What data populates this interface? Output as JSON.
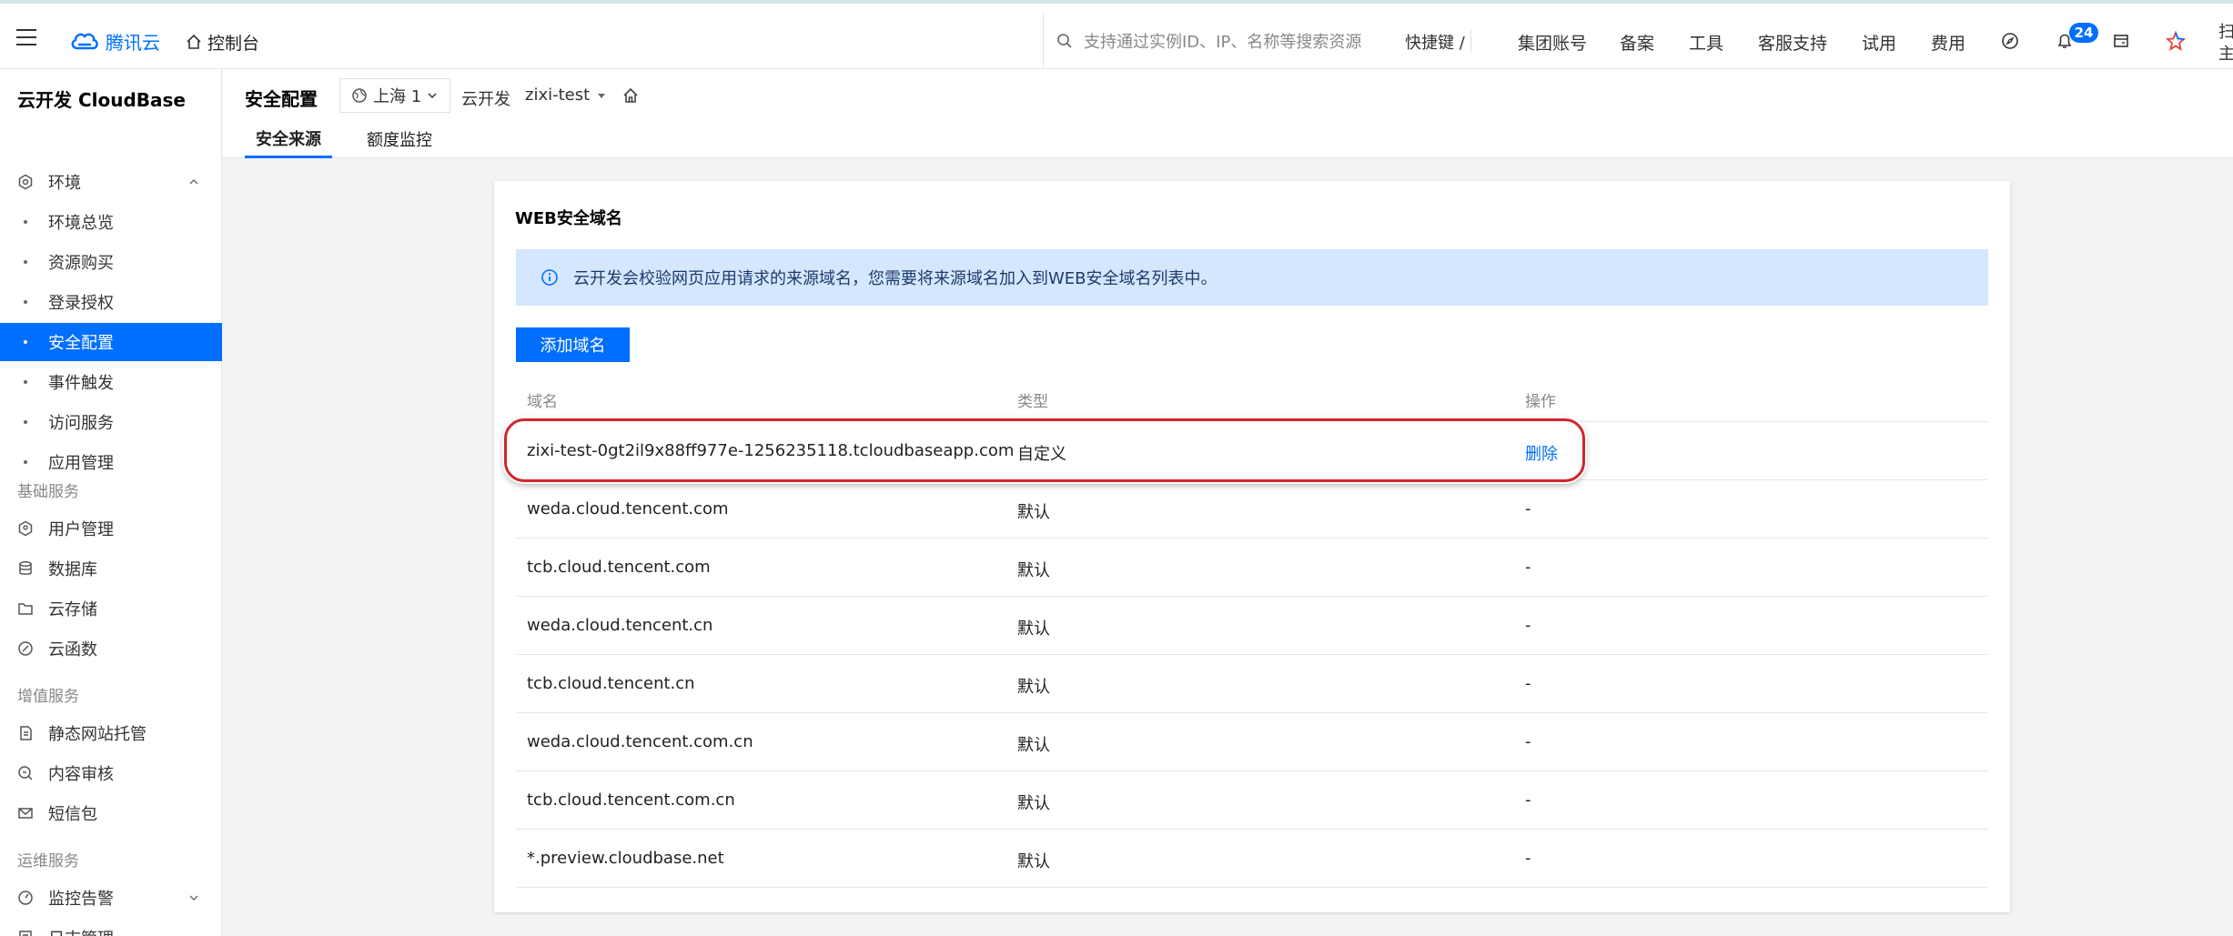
{
  "header": {
    "brand": "腾讯云",
    "console": "控制台",
    "search_placeholder": "支持通过实例ID、IP、名称等搜索资源",
    "shortcut": "快捷键 /",
    "nav": [
      "集团账号",
      "备案",
      "工具",
      "客服支持",
      "试用",
      "费用"
    ],
    "notification_count": "24",
    "edge_text": [
      "扫",
      "主"
    ]
  },
  "sidebar": {
    "title": "云开发 CloudBase",
    "env_section": "环境",
    "env_items": [
      "环境总览",
      "资源购买",
      "登录授权",
      "安全配置",
      "事件触发",
      "访问服务",
      "应用管理"
    ],
    "active_item": "安全配置",
    "group_basic": "基础服务",
    "basic_items": [
      "用户管理",
      "数据库",
      "云存储",
      "云函数"
    ],
    "group_value": "增值服务",
    "value_items": [
      "静态网站托管",
      "内容审核",
      "短信包"
    ],
    "group_ops": "运维服务",
    "ops_items": [
      "监控告警",
      "日志管理"
    ]
  },
  "page": {
    "title": "安全配置",
    "region": "上海 1",
    "env_label": "云开发",
    "env_value": "zixi-test",
    "tabs": [
      "安全来源",
      "额度监控"
    ],
    "active_tab": "安全来源"
  },
  "card": {
    "title": "WEB安全域名",
    "notice": "云开发会校验网页应用请求的来源域名，您需要将来源域名加入到WEB安全域名列表中。",
    "add_button": "添加域名",
    "columns": [
      "域名",
      "类型",
      "操作"
    ],
    "rows": [
      {
        "domain": "zixi-test-0gt2il9x88ff977e-1256235118.tcloudbaseapp.com",
        "type": "自定义",
        "action": "删除"
      },
      {
        "domain": "weda.cloud.tencent.com",
        "type": "默认",
        "action": "-"
      },
      {
        "domain": "tcb.cloud.tencent.com",
        "type": "默认",
        "action": "-"
      },
      {
        "domain": "weda.cloud.tencent.cn",
        "type": "默认",
        "action": "-"
      },
      {
        "domain": "tcb.cloud.tencent.cn",
        "type": "默认",
        "action": "-"
      },
      {
        "domain": "weda.cloud.tencent.com.cn",
        "type": "默认",
        "action": "-"
      },
      {
        "domain": "tcb.cloud.tencent.com.cn",
        "type": "默认",
        "action": "-"
      },
      {
        "domain": "*.preview.cloudbase.net",
        "type": "默认",
        "action": "-"
      }
    ]
  },
  "colors": {
    "primary": "#006eff",
    "notice_bg": "#d5e7fe",
    "highlight_ring": "#d0262a"
  }
}
